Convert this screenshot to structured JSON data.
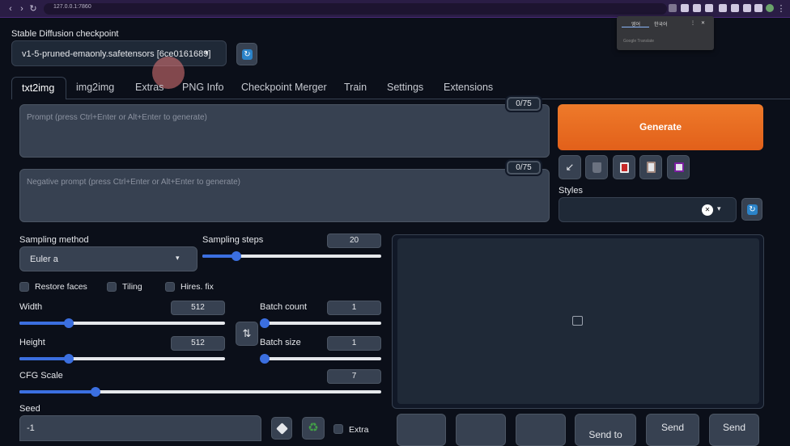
{
  "browser": {
    "url": "127.0.0.1:7860"
  },
  "translate_popup": {
    "tab_one": "영어",
    "tab_two": "한국어",
    "footer": "Google Translate"
  },
  "checkpoint": {
    "label": "Stable Diffusion checkpoint",
    "value": "v1-5-pruned-emaonly.safetensors [6ce0161689]"
  },
  "tabs": [
    "txt2img",
    "img2img",
    "Extras",
    "PNG Info",
    "Checkpoint Merger",
    "Train",
    "Settings",
    "Extensions"
  ],
  "active_tab": "txt2img",
  "prompt": {
    "placeholder": "Prompt (press Ctrl+Enter or Alt+Enter to generate)",
    "counter": "0/75"
  },
  "negative_prompt": {
    "placeholder": "Negative prompt (press Ctrl+Enter or Alt+Enter to generate)",
    "counter": "0/75"
  },
  "generate_label": "Generate",
  "tool_icons": [
    "arrow-diagonal-icon",
    "trash-icon",
    "red-card-icon",
    "clipboard-icon",
    "save-icon"
  ],
  "styles": {
    "label": "Styles",
    "clear_symbol": "✕",
    "dropdown_symbol": "▾"
  },
  "sampling_method": {
    "label": "Sampling method",
    "value": "Euler a"
  },
  "sampling_steps": {
    "label": "Sampling steps",
    "value": "20",
    "fraction": 0.19
  },
  "checkboxes": {
    "restore_faces": "Restore faces",
    "tiling": "Tiling",
    "hires_fix": "Hires. fix",
    "extra": "Extra"
  },
  "width": {
    "label": "Width",
    "value": "512",
    "fraction": 0.24
  },
  "height": {
    "label": "Height",
    "value": "512",
    "fraction": 0.24
  },
  "batch_count": {
    "label": "Batch count",
    "value": "1",
    "fraction": 0.0
  },
  "batch_size": {
    "label": "Batch size",
    "value": "1",
    "fraction": 0.0
  },
  "cfg_scale": {
    "label": "CFG Scale",
    "value": "7",
    "fraction": 0.21
  },
  "seed": {
    "label": "Seed",
    "value": "-1"
  },
  "bottom_buttons": {
    "send_to": "Send to",
    "send_a": "Send",
    "send_b": "Send"
  },
  "colors": {
    "accent": "#ea6a23",
    "slider": "#3b6fe0",
    "background": "#0b0f19"
  }
}
